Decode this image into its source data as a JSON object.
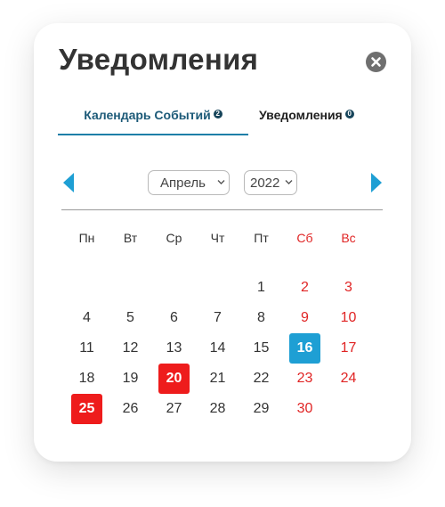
{
  "dialog": {
    "title": "Уведомления",
    "close_icon": "close-circle-icon"
  },
  "tabs": [
    {
      "label": "Календарь Событий",
      "badge": "2",
      "active": true
    },
    {
      "label": "Уведомления",
      "badge": "0",
      "active": false
    }
  ],
  "calendar": {
    "prev_icon": "triangle-left-icon",
    "next_icon": "triangle-right-icon",
    "month": "Апрель",
    "year": "2022",
    "weekdays": [
      "Пн",
      "Вт",
      "Ср",
      "Чт",
      "Пт",
      "Сб",
      "Вс"
    ],
    "weeks": [
      [
        "",
        "",
        "",
        "",
        "1",
        "2",
        "3"
      ],
      [
        "4",
        "5",
        "6",
        "7",
        "8",
        "9",
        "10"
      ],
      [
        "11",
        "12",
        "13",
        "14",
        "15",
        "16",
        "17"
      ],
      [
        "18",
        "19",
        "20",
        "21",
        "22",
        "23",
        "24"
      ],
      [
        "25",
        "26",
        "27",
        "28",
        "29",
        "30",
        ""
      ]
    ],
    "today": "16",
    "event_days": [
      "20",
      "25"
    ]
  },
  "colors": {
    "accent": "#1e7fa8",
    "today": "#1e9fd4",
    "event": "#ee1c1c",
    "weekend": "#e02424"
  }
}
